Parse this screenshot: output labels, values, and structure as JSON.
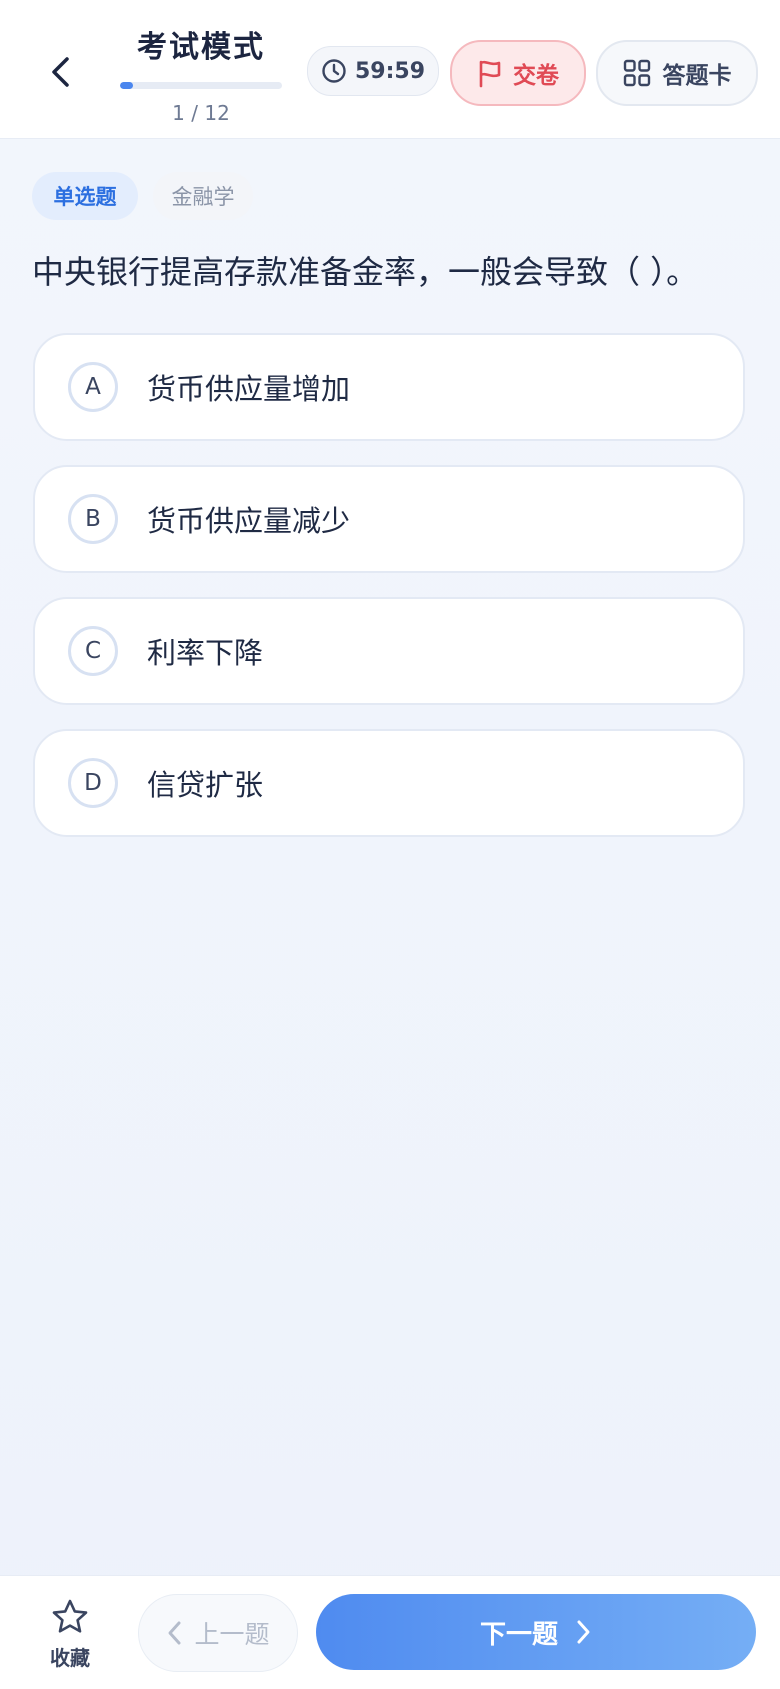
{
  "header": {
    "title": "考试模式",
    "counter": "1 / 12",
    "progress_fraction": 0.083,
    "timer": "59:59",
    "submit_label": "交卷",
    "answer_card_label": "答题卡"
  },
  "tags": {
    "type": "单选题",
    "subject": "金融学"
  },
  "question": "中央银行提高存款准备金率，一般会导致（ ）。",
  "options": [
    {
      "letter": "A",
      "text": "货币供应量增加"
    },
    {
      "letter": "B",
      "text": "货币供应量减少"
    },
    {
      "letter": "C",
      "text": "利率下降"
    },
    {
      "letter": "D",
      "text": "信贷扩张"
    }
  ],
  "bottom": {
    "favorite_label": "收藏",
    "prev_label": "上一题",
    "next_label": "下一题"
  },
  "colors": {
    "accent": "#4b86ee",
    "danger": "#e04a55",
    "text": "#1f2a44"
  }
}
